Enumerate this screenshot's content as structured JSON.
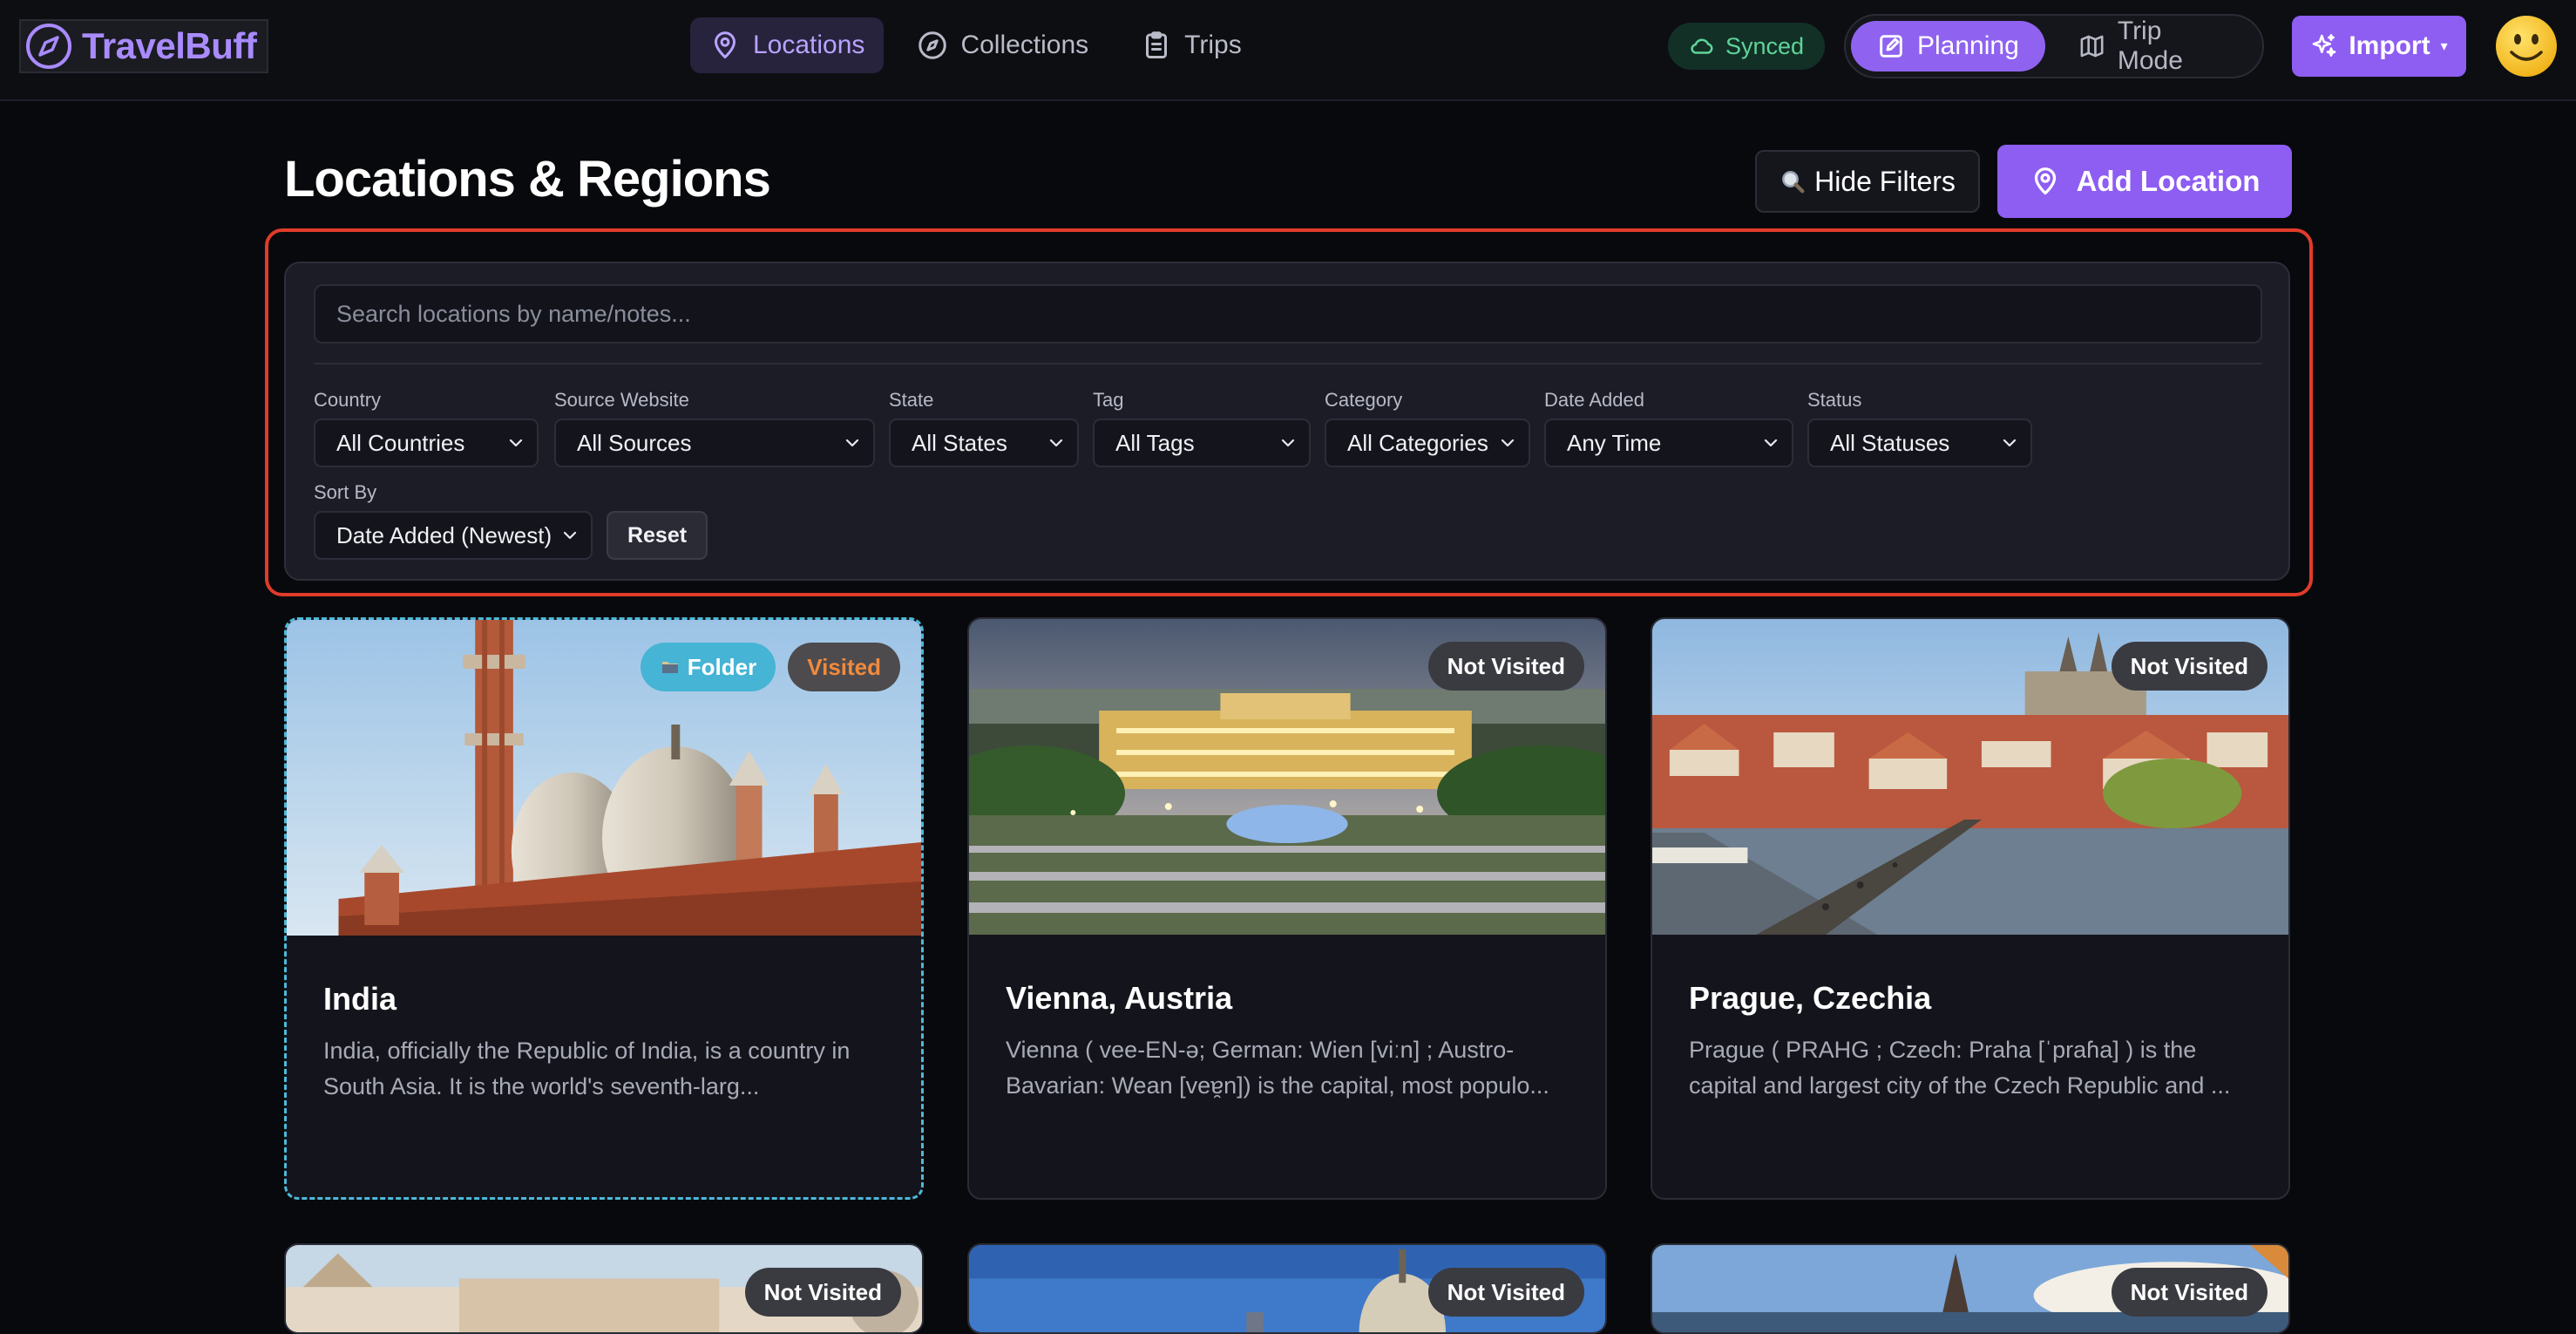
{
  "app": {
    "name": "TravelBuff"
  },
  "nav": {
    "tabs": [
      {
        "label": "Locations",
        "icon": "map-pin-icon",
        "active": true
      },
      {
        "label": "Collections",
        "icon": "compass-icon",
        "active": false
      },
      {
        "label": "Trips",
        "icon": "clipboard-icon",
        "active": false
      }
    ],
    "sync_status": "Synced",
    "modes": [
      {
        "label": "Planning",
        "icon": "edit-icon",
        "active": true
      },
      {
        "label": "Trip Mode",
        "icon": "map-icon",
        "active": false
      }
    ],
    "import_label": "Import",
    "import_caret": "▾"
  },
  "page": {
    "title": "Locations & Regions",
    "hide_filters_label": "Hide Filters",
    "add_location_label": "Add Location"
  },
  "filters": {
    "search_placeholder": "Search locations by name/notes...",
    "country": {
      "label": "Country",
      "value": "All Countries"
    },
    "source": {
      "label": "Source Website",
      "value": "All Sources"
    },
    "state": {
      "label": "State",
      "value": "All States"
    },
    "tag": {
      "label": "Tag",
      "value": "All Tags"
    },
    "category": {
      "label": "Category",
      "value": "All Categories"
    },
    "date_added": {
      "label": "Date Added",
      "value": "Any Time"
    },
    "status": {
      "label": "Status",
      "value": "All Statuses"
    },
    "sort": {
      "label": "Sort By",
      "value": "Date Added (Newest)"
    },
    "reset_label": "Reset"
  },
  "cards": [
    {
      "title": "India",
      "description": "India, officially the Republic of India, is a country in South Asia. It is the world's seventh-larg...",
      "folder_badge": "Folder",
      "status_badge": "Visited"
    },
    {
      "title": "Vienna, Austria",
      "description": "Vienna ( vee-EN-ə; German: Wien [viːn] ; Austro-Bavarian: Wean [veɐ̯n]) is the capital, most populo...",
      "status_badge": "Not Visited"
    },
    {
      "title": "Prague, Czechia",
      "description": "Prague ( PRAHG ; Czech: Praha [ˈpraɦa] ) is the capital and largest city of the Czech Republic and ...",
      "status_badge": "Not Visited"
    },
    {
      "status_badge": "Not Visited"
    },
    {
      "status_badge": "Not Visited"
    },
    {
      "status_badge": "Not Visited"
    }
  ]
}
